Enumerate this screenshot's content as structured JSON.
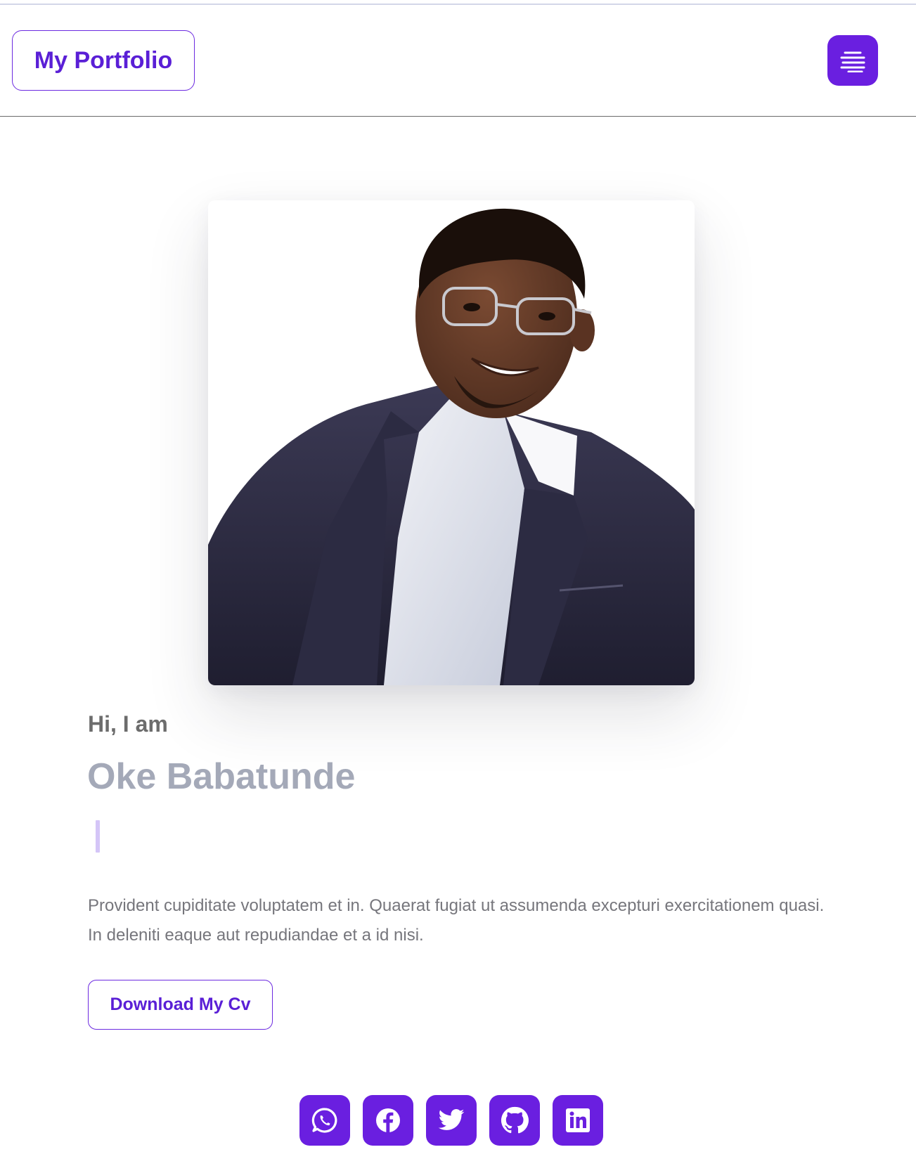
{
  "header": {
    "brand_label": "My Portfolio",
    "menu_icon": "menu-icon"
  },
  "hero": {
    "photo_alt": "Portrait photo",
    "greeting": "Hi, I am",
    "name": "Oke Babatunde",
    "bio": "Provident cupiditate voluptatem et in. Quaerat fugiat ut assumenda excepturi exercitationem quasi. In deleniti eaque aut repudiandae et a id nisi.",
    "cv_button_label": "Download My Cv"
  },
  "socials": [
    {
      "name": "whatsapp",
      "icon": "whatsapp-icon"
    },
    {
      "name": "facebook",
      "icon": "facebook-icon"
    },
    {
      "name": "twitter",
      "icon": "twitter-icon"
    },
    {
      "name": "github",
      "icon": "github-icon"
    },
    {
      "name": "linkedin",
      "icon": "linkedin-icon"
    }
  ],
  "colors": {
    "accent": "#6a1fe0",
    "accent_text": "#5a1fd6",
    "name_text": "#a4a9b8",
    "greeting_text": "#6c6c6c",
    "body_text": "#76767c"
  }
}
